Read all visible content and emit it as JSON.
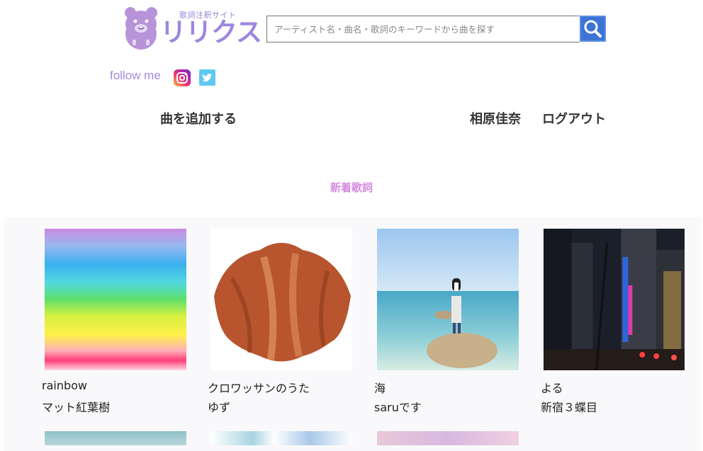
{
  "logo": {
    "tagline": "歌詞注釈サイト",
    "name": "リリクス"
  },
  "search": {
    "placeholder": "アーティスト名・曲名・歌詞のキーワードから曲を探す",
    "value": "",
    "button_icon": "search-icon"
  },
  "social": {
    "follow_label": "follow me",
    "icons": [
      "instagram-icon",
      "twitter-icon"
    ]
  },
  "nav": {
    "add_song": "曲を追加する",
    "user_name": "相原佳奈",
    "logout": "ログアウト"
  },
  "section": {
    "title": "新着歌詞"
  },
  "songs": [
    {
      "title": "rainbow",
      "artist": "マット紅葉樹"
    },
    {
      "title": "クロワッサンのうた",
      "artist": "ゆず"
    },
    {
      "title": "海",
      "artist": "saruです"
    },
    {
      "title": "よる",
      "artist": "新宿３蝶目"
    }
  ],
  "colors": {
    "brand": "#9d86de",
    "accent_pink": "#d48ae0",
    "search_button": "#3d73d6"
  }
}
